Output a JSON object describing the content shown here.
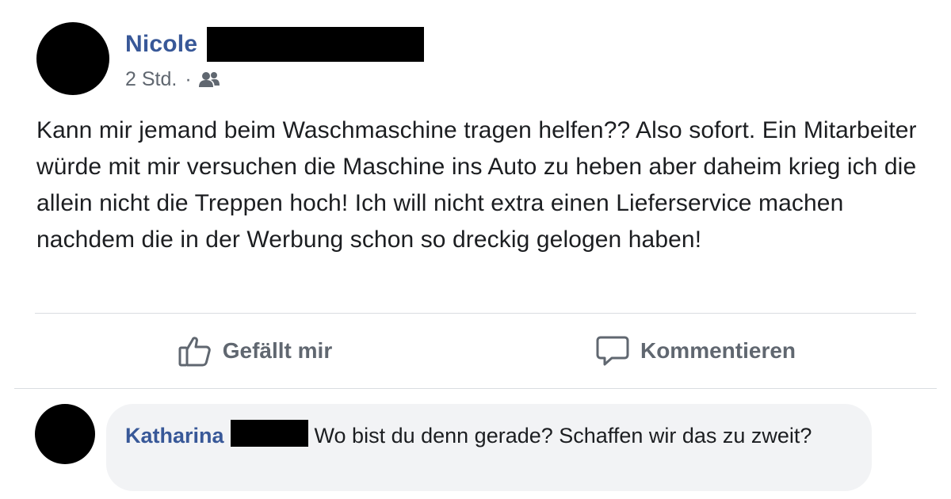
{
  "post": {
    "author_first_name": "Nicole",
    "timestamp": "2 Std.",
    "separator": "·",
    "audience_icon": "friends-icon",
    "text": "Kann mir jemand beim Waschmaschine tragen helfen?? Also sofort. Ein Mitarbeiter würde mit mir versuchen die Maschine ins Auto zu heben aber daheim krieg ich die allein nicht die Treppen hoch! Ich will nicht extra einen Lieferservice machen nachdem die in der Werbung schon so dreckig gelogen haben!"
  },
  "actions": {
    "like_label": "Gefällt mir",
    "like_icon": "thumbs-up-icon",
    "comment_label": "Kommentieren",
    "comment_icon": "speech-bubble-icon"
  },
  "comment": {
    "author_first_name": "Katharina",
    "text": "Wo bist du denn gerade? Schaffen wir das zu zweit?"
  },
  "colors": {
    "name_link": "#385898",
    "secondary_text": "#606770",
    "bubble_bg": "#f2f3f5",
    "divider": "#dadde1"
  }
}
